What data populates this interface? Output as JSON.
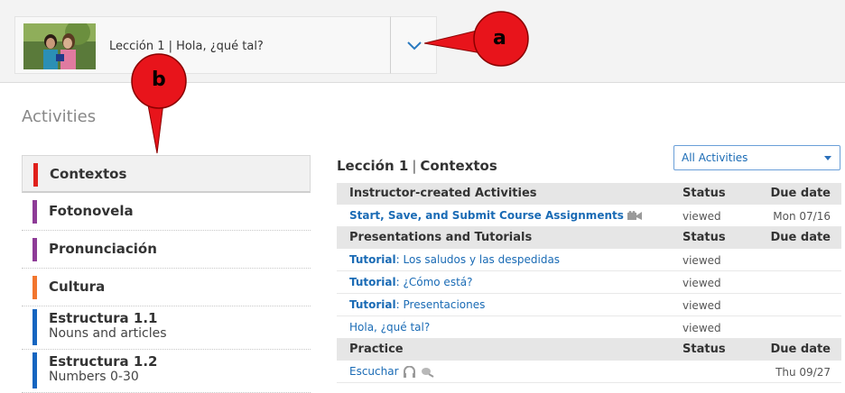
{
  "header": {
    "lesson_title": "Lección 1 | Hola, ¿qué tal?"
  },
  "callouts": {
    "a": "a",
    "b": "b"
  },
  "page": {
    "heading": "Activities"
  },
  "sidebar": {
    "items": [
      {
        "label": "Contextos",
        "sub": "",
        "color": "#e0201b",
        "active": true
      },
      {
        "label": "Fotonovela",
        "sub": "",
        "color": "#8e3b97"
      },
      {
        "label": "Pronunciación",
        "sub": "",
        "color": "#8e3b97"
      },
      {
        "label": "Cultura",
        "sub": "",
        "color": "#f2762e"
      },
      {
        "label": "Estructura 1.1",
        "sub": "Nouns and articles",
        "color": "#1565c0"
      },
      {
        "label": "Estructura 1.2",
        "sub": "Numbers 0-30",
        "color": "#1565c0"
      }
    ]
  },
  "content": {
    "title_lesson": "Lección 1",
    "title_separator": "|",
    "title_section": "Contextos",
    "filter": {
      "selected": "All Activities"
    }
  },
  "table": {
    "groups": [
      {
        "header": {
          "name": "Instructor-created Activities",
          "status": "Status",
          "due": "Due date"
        },
        "rows": [
          {
            "prefix": "Start, Save, and Submit Course Assignments",
            "name": "",
            "status": "viewed",
            "due": "Mon 07/16",
            "icon": "video-camera-icon"
          }
        ]
      },
      {
        "header": {
          "name": "Presentations and Tutorials",
          "status": "Status",
          "due": "Due date"
        },
        "rows": [
          {
            "prefix": "Tutorial",
            "name": ": Los saludos y las despedidas",
            "status": "viewed",
            "due": ""
          },
          {
            "prefix": "Tutorial",
            "name": ": ¿Cómo está?",
            "status": "viewed",
            "due": ""
          },
          {
            "prefix": "Tutorial",
            "name": ": Presentaciones",
            "status": "viewed",
            "due": ""
          },
          {
            "prefix": "",
            "name": "Hola, ¿qué tal?",
            "status": "viewed",
            "due": ""
          }
        ]
      },
      {
        "header": {
          "name": "Practice",
          "status": "Status",
          "due": "Due date"
        },
        "rows": [
          {
            "prefix": "",
            "name": "Escuchar",
            "status": "",
            "due": "Thu 09/27",
            "icon": "headphones-icon"
          }
        ]
      }
    ]
  },
  "colors": {
    "callout_red": "#e8141b",
    "callout_outline": "#b30000",
    "link_blue": "#1a6bb5"
  }
}
